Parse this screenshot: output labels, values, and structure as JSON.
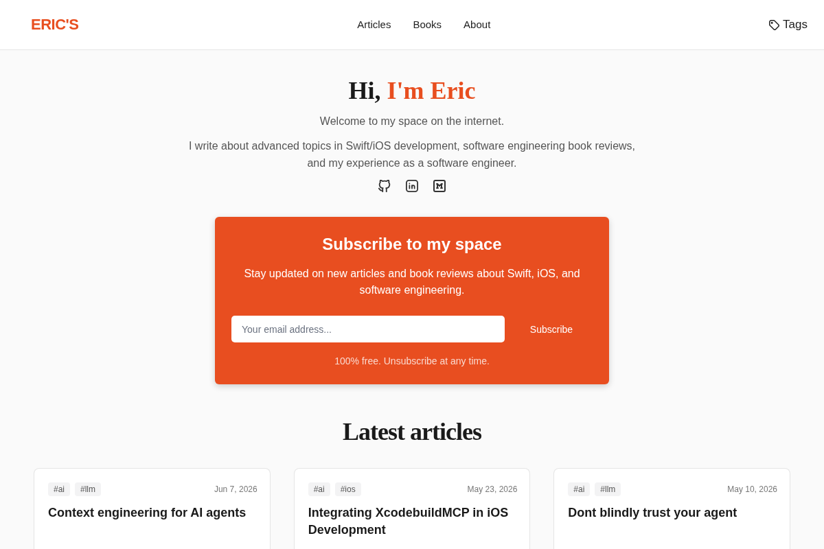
{
  "header": {
    "logo": "ERIC'S",
    "nav": [
      "Articles",
      "Books",
      "About"
    ],
    "tags_link": "Tags"
  },
  "hero": {
    "greeting": "Hi,",
    "name": "I'm Eric",
    "welcome": "Welcome to my space on the internet.",
    "bio": "I write about advanced topics in Swift/iOS development, software engineering book reviews, and my experience as a software engineer.",
    "social_links": [
      {
        "kind": "github"
      },
      {
        "kind": "linkedin"
      },
      {
        "kind": "medium"
      }
    ]
  },
  "subscribe": {
    "title": "Subscribe to my space",
    "text": "Stay updated on new articles and book reviews about Swift, iOS, and software engineering.",
    "email_field": {
      "placeholder": "Your email address..."
    },
    "button": "Subscribe",
    "note": "100% free. Unsubscribe at any time."
  },
  "articles": {
    "title": "Latest articles",
    "cards": [
      {
        "tags": [
          "#ai",
          "#llm"
        ],
        "date": "Jun 7, 2026",
        "title": "Context engineering for AI agents"
      },
      {
        "tags": [
          "#ai",
          "#ios"
        ],
        "date": "May 23, 2026",
        "title": "Integrating XcodebuildMCP in iOS Development"
      },
      {
        "tags": [
          "#ai",
          "#llm"
        ],
        "date": "May 10, 2026",
        "title": "Dont blindly trust your agent"
      }
    ]
  }
}
